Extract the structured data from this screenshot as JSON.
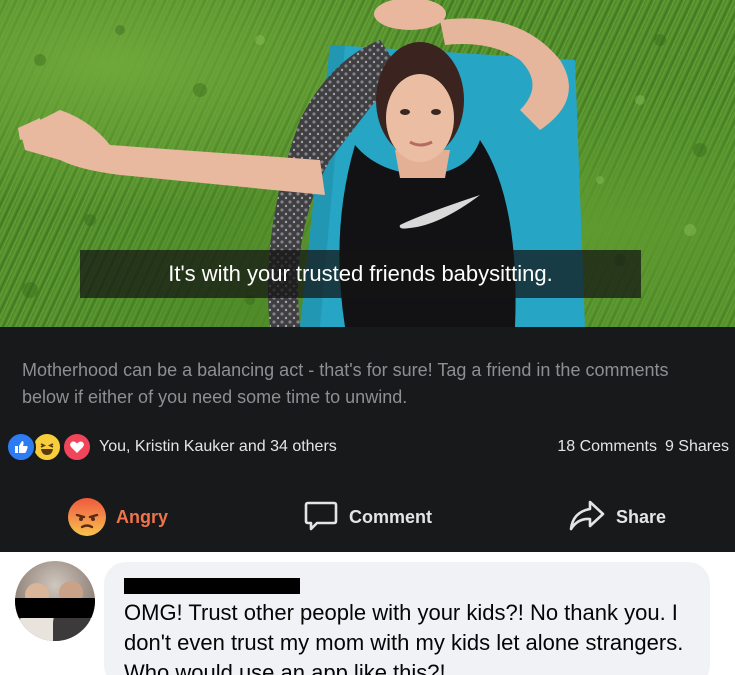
{
  "video": {
    "subtitle": "It's with your trusted friends babysitting."
  },
  "post": {
    "caption": "Motherhood can be a balancing act - that's for sure! Tag a friend in the comments below if either of you need some time to unwind.",
    "reactions": {
      "icons": [
        "like-icon",
        "haha-icon",
        "love-icon"
      ],
      "summary": "You, Kristin Kauker and 34 others"
    },
    "comments_count": "18 Comments",
    "shares_count": "9 Shares",
    "actions": {
      "angry_label": "Angry",
      "comment_label": "Comment",
      "share_label": "Share"
    },
    "colors": {
      "background": "#18191b",
      "angry": "#f0734a",
      "like": "#2d7cf2",
      "love": "#f0455a",
      "haha": "#f8cd3c"
    }
  },
  "comment": {
    "text": "OMG! Trust other people with your kids?! No thank you. I don't even trust my mom with my kids let alone strangers. Who would use an app like this?!"
  }
}
